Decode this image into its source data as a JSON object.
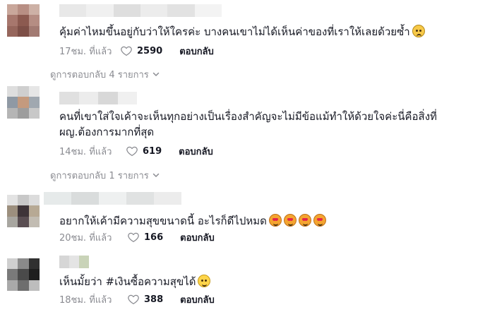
{
  "comments": [
    {
      "text": "คุ้มค่าไหมขึ้นอยู่กับว่าให้ใครค่ะ บางคนเขาไม่ได้เห็นค่าของที่เราให้เลยด้วยซ้ำ",
      "emoji": [
        "frowning-face"
      ],
      "time": "17ชม. ที่แล้ว",
      "likes": "2590",
      "reply_label": "ตอบกลับ",
      "view_replies": "ดูการตอบกลับ 4 รายการ"
    },
    {
      "text": "คนที่เขาใส่ใจเค้าจะเห็นทุกอย่างเป็นเรื่องสำคัญจะไม่มีข้อแม้ทำให้ด้วยใจค่ะนี่คือสิ่งที่ผญ.ต้องการมากที่สุด",
      "emoji": [],
      "time": "14ชม. ที่แล้ว",
      "likes": "619",
      "reply_label": "ตอบกลับ",
      "view_replies": "ดูการตอบกลับ 1 รายการ"
    },
    {
      "text": "อยากให้เค้ามีความสุขขนาดนี้ อะไรก็ดีไปหมด",
      "emoji": [
        "smiling-face-with-heart-eyes",
        "smiling-face-with-heart-eyes",
        "smiling-face-with-heart-eyes",
        "smiling-face-with-heart-eyes"
      ],
      "time": "20ชม. ที่แล้ว",
      "likes": "166",
      "reply_label": "ตอบกลับ"
    },
    {
      "text": "เห็นมั้ยว่า #เงินซื้อความสุขได้",
      "emoji": [
        "smiling-face"
      ],
      "time": "18ชม. ที่แล้ว",
      "likes": "388",
      "reply_label": "ตอบกลับ"
    }
  ],
  "colors": {
    "text_primary": "#161823",
    "text_secondary": "#8a8b91",
    "background": "#ffffff"
  }
}
